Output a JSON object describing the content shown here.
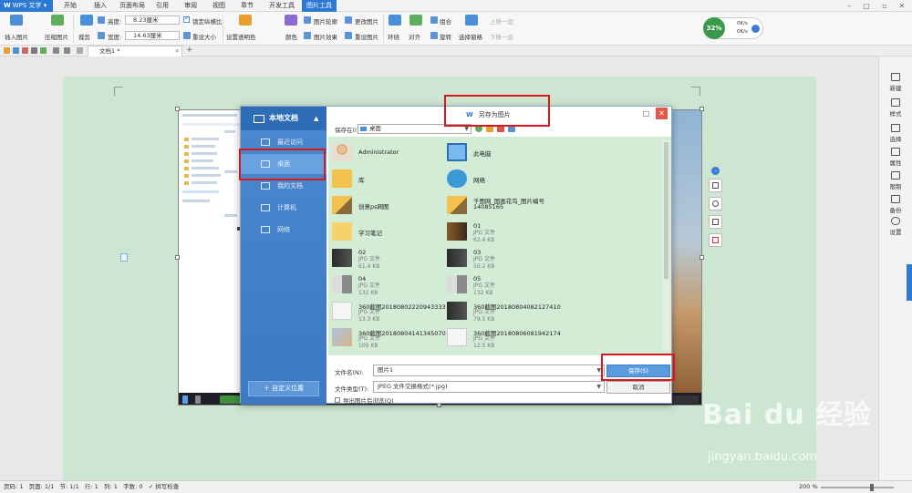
{
  "app": {
    "name": "WPS 文字"
  },
  "menu": {
    "tabs": [
      "开始",
      "插入",
      "页面布局",
      "引用",
      "审阅",
      "视图",
      "章节",
      "开发工具",
      "图片工具"
    ],
    "active": "图片工具"
  },
  "ribbon": {
    "insert_picture": "插入图片",
    "compress_picture": "压缩图片",
    "crop": "裁剪",
    "height_label": "高度:",
    "height_value": "8.23厘米",
    "width_label": "宽度:",
    "width_value": "14.63厘米",
    "lock_ratio": "锁定纵横比",
    "reset_size": "重设大小",
    "set_transparent": "设置透明色",
    "color": "颜色",
    "picture_outline": "图片轮廓",
    "picture_effect": "图片效果",
    "change_picture": "更改图片",
    "reset_picture": "重设图片",
    "wrap": "环绕",
    "align": "对齐",
    "group": "组合",
    "rotate": "旋转",
    "selection_pane": "选择窗格",
    "bring_forward": "上移一层",
    "send_backward": "下移一层"
  },
  "speed": {
    "percent": "32%",
    "up": "0K/s",
    "down": "0K/s"
  },
  "document": {
    "tab_name": "文档1 *"
  },
  "right_panel": [
    "新建",
    "样式",
    "选择",
    "属性",
    "限制",
    "备份",
    "设置"
  ],
  "status": {
    "text": "页码: 1   页面: 1/1   节: 1/1   行: 1   列: 1   字数: 0   ✓ 拼写检查",
    "zoom": "200 %"
  },
  "dialog": {
    "title": "另存为图片",
    "nav_header": "本地文档",
    "nav_items": [
      "最近访问",
      "桌面",
      "我的文档",
      "计算机",
      "网络"
    ],
    "nav_selected": "桌面",
    "custom_location": "自定义位置",
    "save_in_label": "保存在(I):",
    "save_in_value": "桌面",
    "files": [
      {
        "name": "Administrator",
        "meta": ""
      },
      {
        "name": "此电脑",
        "meta": ""
      },
      {
        "name": "库",
        "meta": ""
      },
      {
        "name": "网络",
        "meta": ""
      },
      {
        "name": "创意ps网图",
        "meta": ""
      },
      {
        "name": "千图网_国画花鸟_图片编号",
        "name2": "14085165",
        "meta": ""
      },
      {
        "name": "学习笔记",
        "meta": ""
      },
      {
        "name": "01",
        "meta": "JPG 文件",
        "size": "62.4 KB"
      },
      {
        "name": "02",
        "meta": "JPG 文件",
        "size": "61.4 KB"
      },
      {
        "name": "03",
        "meta": "JPG 文件",
        "size": "50.2 KB"
      },
      {
        "name": "04",
        "meta": "JPG 文件",
        "size": "132 KB"
      },
      {
        "name": "05",
        "meta": "JPG 文件",
        "size": "132 KB"
      },
      {
        "name": "360截图20180802220943333",
        "meta": "JPG 文件",
        "size": "13.3 KB"
      },
      {
        "name": "360截图20180804082127410",
        "meta": "JPG 文件",
        "size": "79.5 KB"
      },
      {
        "name": "360截图20180804141345070",
        "meta": "JPG 文件",
        "size": "109 KB"
      },
      {
        "name": "360截图20180806081942174",
        "meta": "JPG 文件",
        "size": "12.5 KB"
      }
    ],
    "filename_label": "文件名(N):",
    "filename_value": "图片1",
    "filetype_label": "文件类型(T):",
    "filetype_value": "JPEG 文件交换格式(*.jpg)",
    "save_button": "保存(S)",
    "cancel_button": "取消",
    "browse_after_export": "导出图片后浏览(Q)"
  },
  "watermark": {
    "logo": "Bai du 经验",
    "url": "jingyan.baidu.com"
  }
}
